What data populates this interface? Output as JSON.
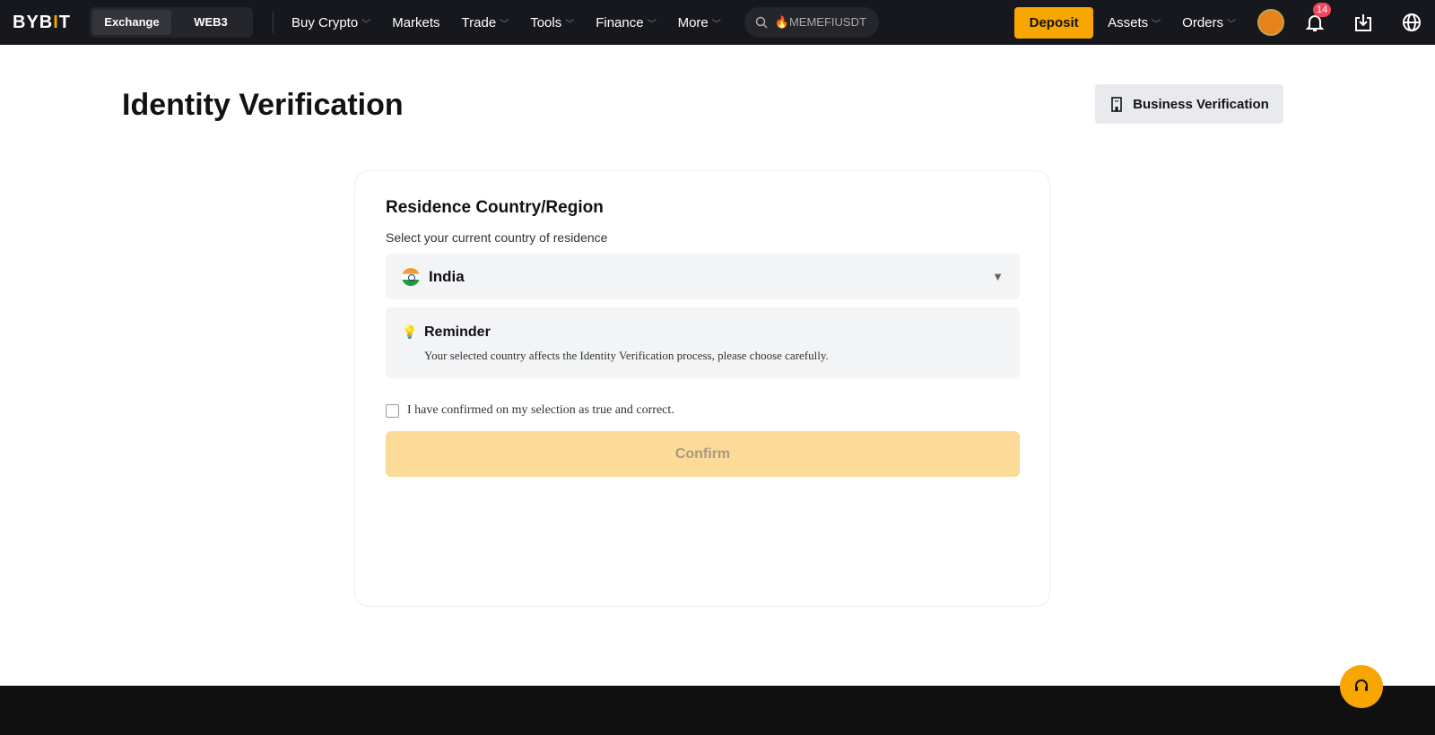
{
  "nav": {
    "logo": "BYBIT",
    "tabs": [
      "Exchange",
      "WEB3"
    ],
    "menu": [
      "Buy Crypto",
      "Markets",
      "Trade",
      "Tools",
      "Finance",
      "More"
    ],
    "search": "MEMEFIUSDT",
    "deposit": "Deposit",
    "assets": "Assets",
    "orders": "Orders",
    "notif_count": "14"
  },
  "page": {
    "title": "Identity Verification",
    "business_button": "Business Verification"
  },
  "card": {
    "title": "Residence Country/Region",
    "subtitle": "Select your current country of residence",
    "country": "India",
    "reminder_title": "Reminder",
    "reminder_text": "Your selected country affects the Identity Verification process, please choose carefully.",
    "checkbox_label": "I have confirmed on my selection as true and correct.",
    "confirm": "Confirm"
  }
}
